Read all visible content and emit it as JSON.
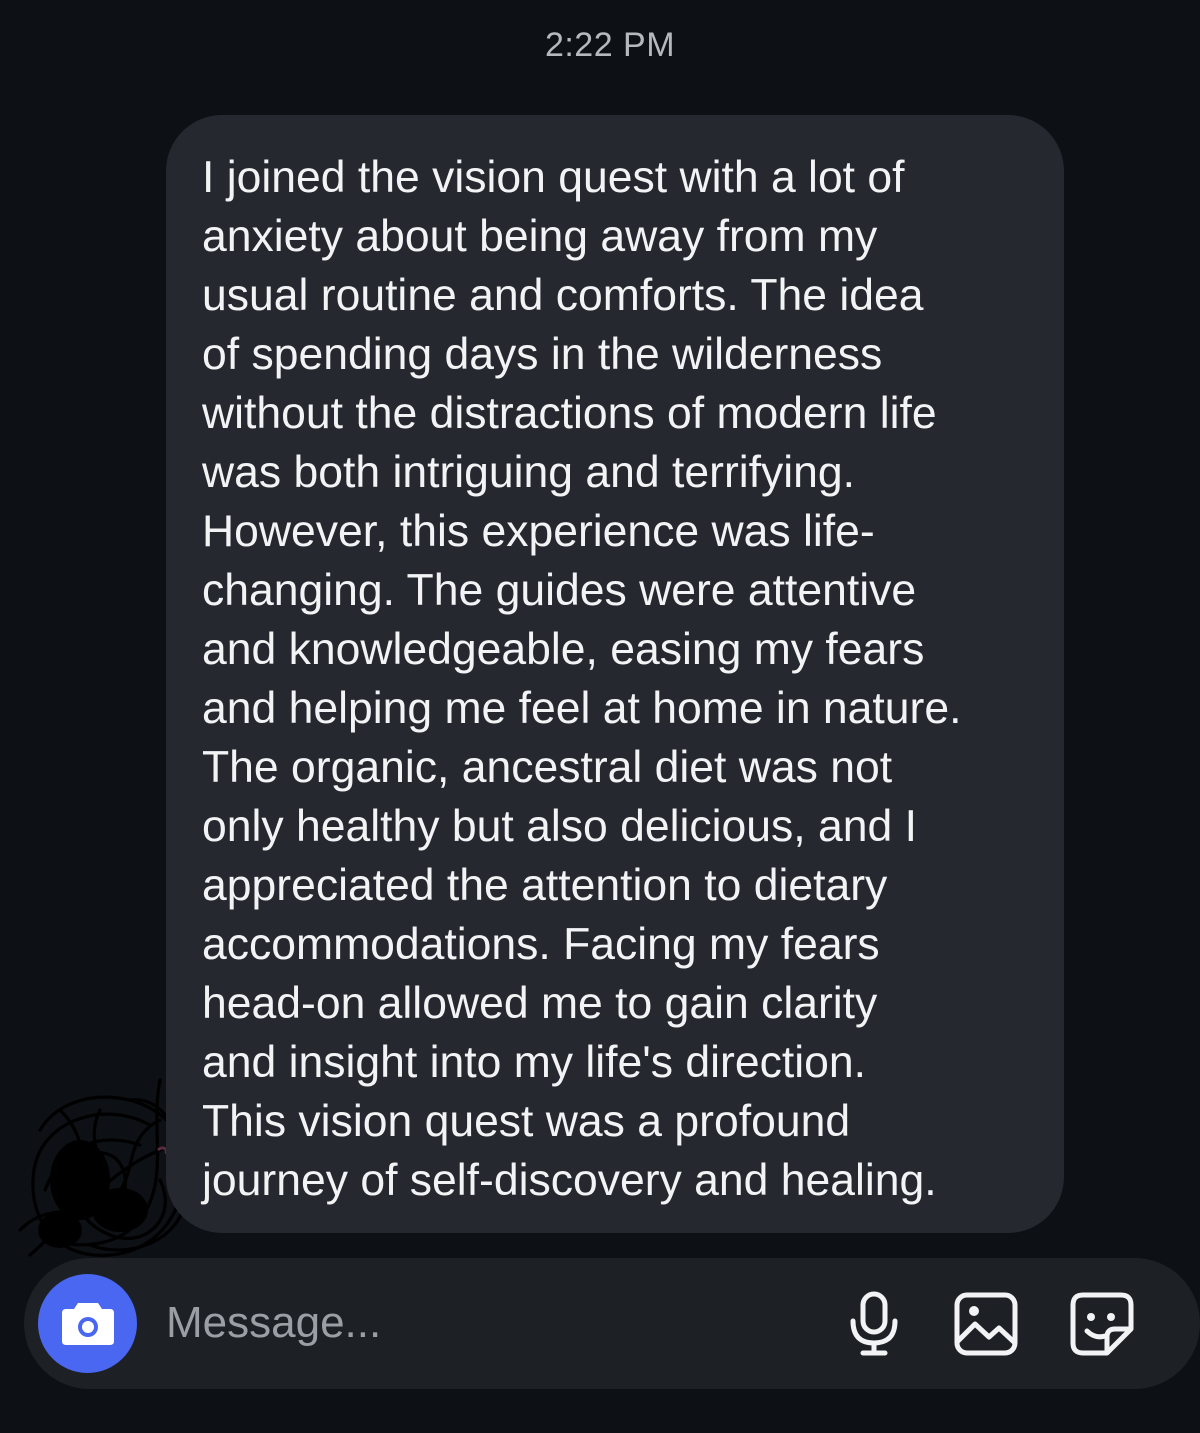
{
  "header": {
    "timestamp": "2:22 PM"
  },
  "message": {
    "text": "I joined the vision quest with a lot of\nanxiety about being away from my\nusual routine and comforts. The idea\nof spending days in the wilderness\nwithout the distractions of modern life\nwas both intriguing and terrifying.\nHowever, this experience was life-\nchanging. The guides were attentive\nand knowledgeable, easing my fears\nand helping me feel at home in nature.\nThe organic, ancestral diet was not\nonly healthy but also delicious, and I\nappreciated the attention to dietary\naccommodations. Facing my fears\nhead-on allowed me to gain clarity\nand insight into my life's direction.\nThis vision quest was a profound\njourney of self-discovery and healing."
  },
  "composer": {
    "placeholder": "Message...",
    "icons": {
      "camera": "camera-icon",
      "microphone": "microphone-icon",
      "gallery": "gallery-icon",
      "sticker": "sticker-icon"
    }
  },
  "colors": {
    "background": "#0d1014",
    "bubble": "#25292f",
    "composer": "#1d2126",
    "camera_accent": "#4a67f2",
    "text": "#f2f3f5",
    "muted_text": "#9a9ea5"
  }
}
